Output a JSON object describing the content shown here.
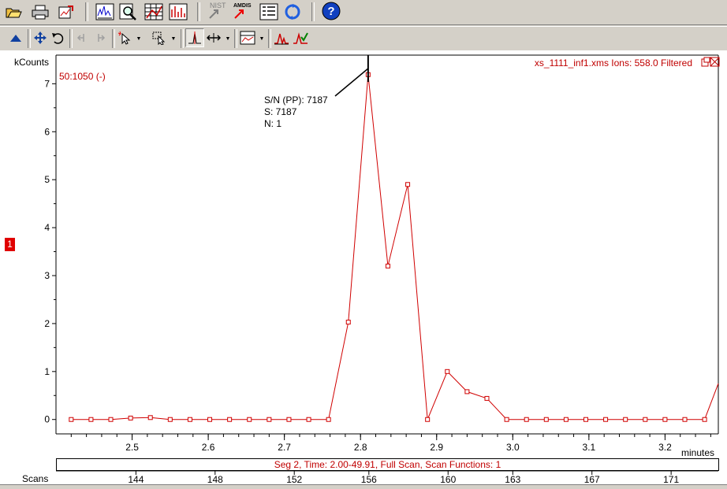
{
  "chart_data": {
    "type": "line",
    "title": "xs_1111_inf1.xms Ions: 558.0 Filtered",
    "mass_range": "50:1050 (-)",
    "ylabel": "kCounts",
    "xlabel": "minutes",
    "scans_label": "Scans",
    "xlim": [
      2.4,
      3.27
    ],
    "ylim": [
      -0.3,
      7.4
    ],
    "x_ticks": [
      "2.5",
      "2.6",
      "2.7",
      "2.8",
      "2.9",
      "3.0",
      "3.1",
      "3.2"
    ],
    "y_ticks": [
      "0",
      "1",
      "2",
      "3",
      "4",
      "5",
      "6",
      "7"
    ],
    "scan_ticks": [
      {
        "time": 2.505,
        "label": "144"
      },
      {
        "time": 2.609,
        "label": "148"
      },
      {
        "time": 2.713,
        "label": "152"
      },
      {
        "time": 2.811,
        "label": "156"
      },
      {
        "time": 2.915,
        "label": "160"
      },
      {
        "time": 3.0,
        "label": "163"
      },
      {
        "time": 3.104,
        "label": "167"
      },
      {
        "time": 3.208,
        "label": "171"
      }
    ],
    "series": [
      {
        "color": "#d00000",
        "x": [
          2.42,
          2.446,
          2.472,
          2.498,
          2.524,
          2.55,
          2.576,
          2.602,
          2.628,
          2.654,
          2.68,
          2.706,
          2.732,
          2.758,
          2.784,
          2.81,
          2.836,
          2.862,
          2.888,
          2.914,
          2.94,
          2.966,
          2.992,
          3.018,
          3.044,
          3.07,
          3.096,
          3.122,
          3.148,
          3.174,
          3.2,
          3.226,
          3.252,
          3.27
        ],
        "y": [
          0,
          0,
          0,
          0.03,
          0.04,
          0,
          0,
          0,
          0,
          0,
          0,
          0,
          0,
          0,
          2.03,
          7.19,
          3.2,
          4.9,
          0,
          1.0,
          0.58,
          0.44,
          0,
          0,
          0,
          0,
          0,
          0,
          0,
          0,
          0,
          0,
          0,
          0.75
        ],
        "marker": "square"
      }
    ],
    "peak_annotation": {
      "x": 2.81,
      "lines": [
        "S/N (PP): 7187",
        "S: 7187",
        "N: 1"
      ]
    },
    "trace_number": "1",
    "segment_info": "Seg 2, Time: 2.00-49.91, Full Scan, Scan Functions: 1"
  },
  "toolbar_top": [
    {
      "name": "open-folder-icon"
    },
    {
      "name": "print-icon"
    },
    {
      "name": "export-chart-icon"
    },
    {
      "name": "spectrum-icon"
    },
    {
      "name": "zoom-search-icon"
    },
    {
      "name": "table-chart-icon"
    },
    {
      "name": "report-chart-icon"
    },
    {
      "name": "nist-search-icon",
      "label": "NIST"
    },
    {
      "name": "amdis-icon",
      "label": "AMDIS"
    },
    {
      "name": "list-view-icon"
    },
    {
      "name": "refresh-arrows-icon"
    },
    {
      "name": "help-icon",
      "label": "?"
    }
  ]
}
